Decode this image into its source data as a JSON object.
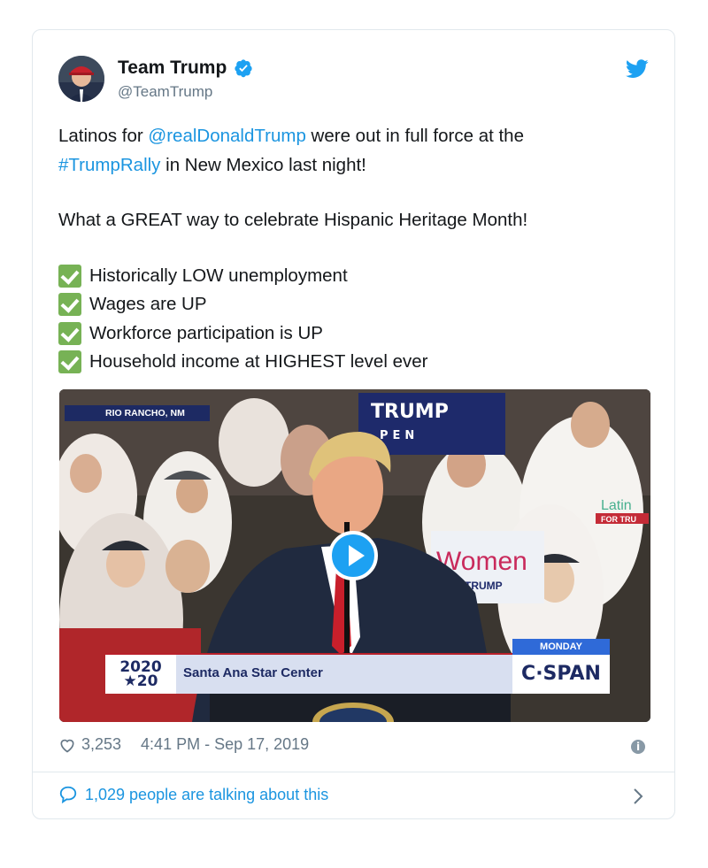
{
  "tweet": {
    "display_name": "Team Trump",
    "handle": "@TeamTrump",
    "text_line1_pre": "Latinos for ",
    "text_line1_mention": "@realDonaldTrump",
    "text_line1_post": " were out in full force at the",
    "text_line2_hashtag": "#TrumpRally",
    "text_line2_post": " in New Mexico last night!",
    "text_line3": "What a GREAT way to celebrate Hispanic Heritage Month!",
    "checklist": [
      "Historically LOW unemployment",
      "Wages are UP",
      "Workforce participation is UP",
      "Household income at HIGHEST level ever"
    ]
  },
  "media": {
    "location_banner": "RIO RANCHO, NM",
    "logo_line1": "2020",
    "logo_line2": "★20",
    "venue": "Santa Ana Star Center",
    "day": "MONDAY",
    "network": "C·SPAN",
    "sign_text": "TRUMP",
    "sign_text2": "PEN",
    "sign_women": "Women",
    "sign_women_sub": "TRUMP",
    "shirt_text": "Latin",
    "shirt_sub": "FOR TRU"
  },
  "footer": {
    "likes": "3,253",
    "timestamp": "4:41 PM - Sep 17, 2019",
    "talking": "1,029 people are talking about this"
  },
  "colors": {
    "link": "#1b95e0",
    "verified": "#1da1f2",
    "check": "#77b255",
    "muted": "#657786"
  },
  "icons": [
    "verified-icon",
    "twitter-bird-icon",
    "heart-icon",
    "info-icon",
    "comment-bubble-icon",
    "chevron-right-icon",
    "play-icon",
    "checkmark-icon"
  ]
}
